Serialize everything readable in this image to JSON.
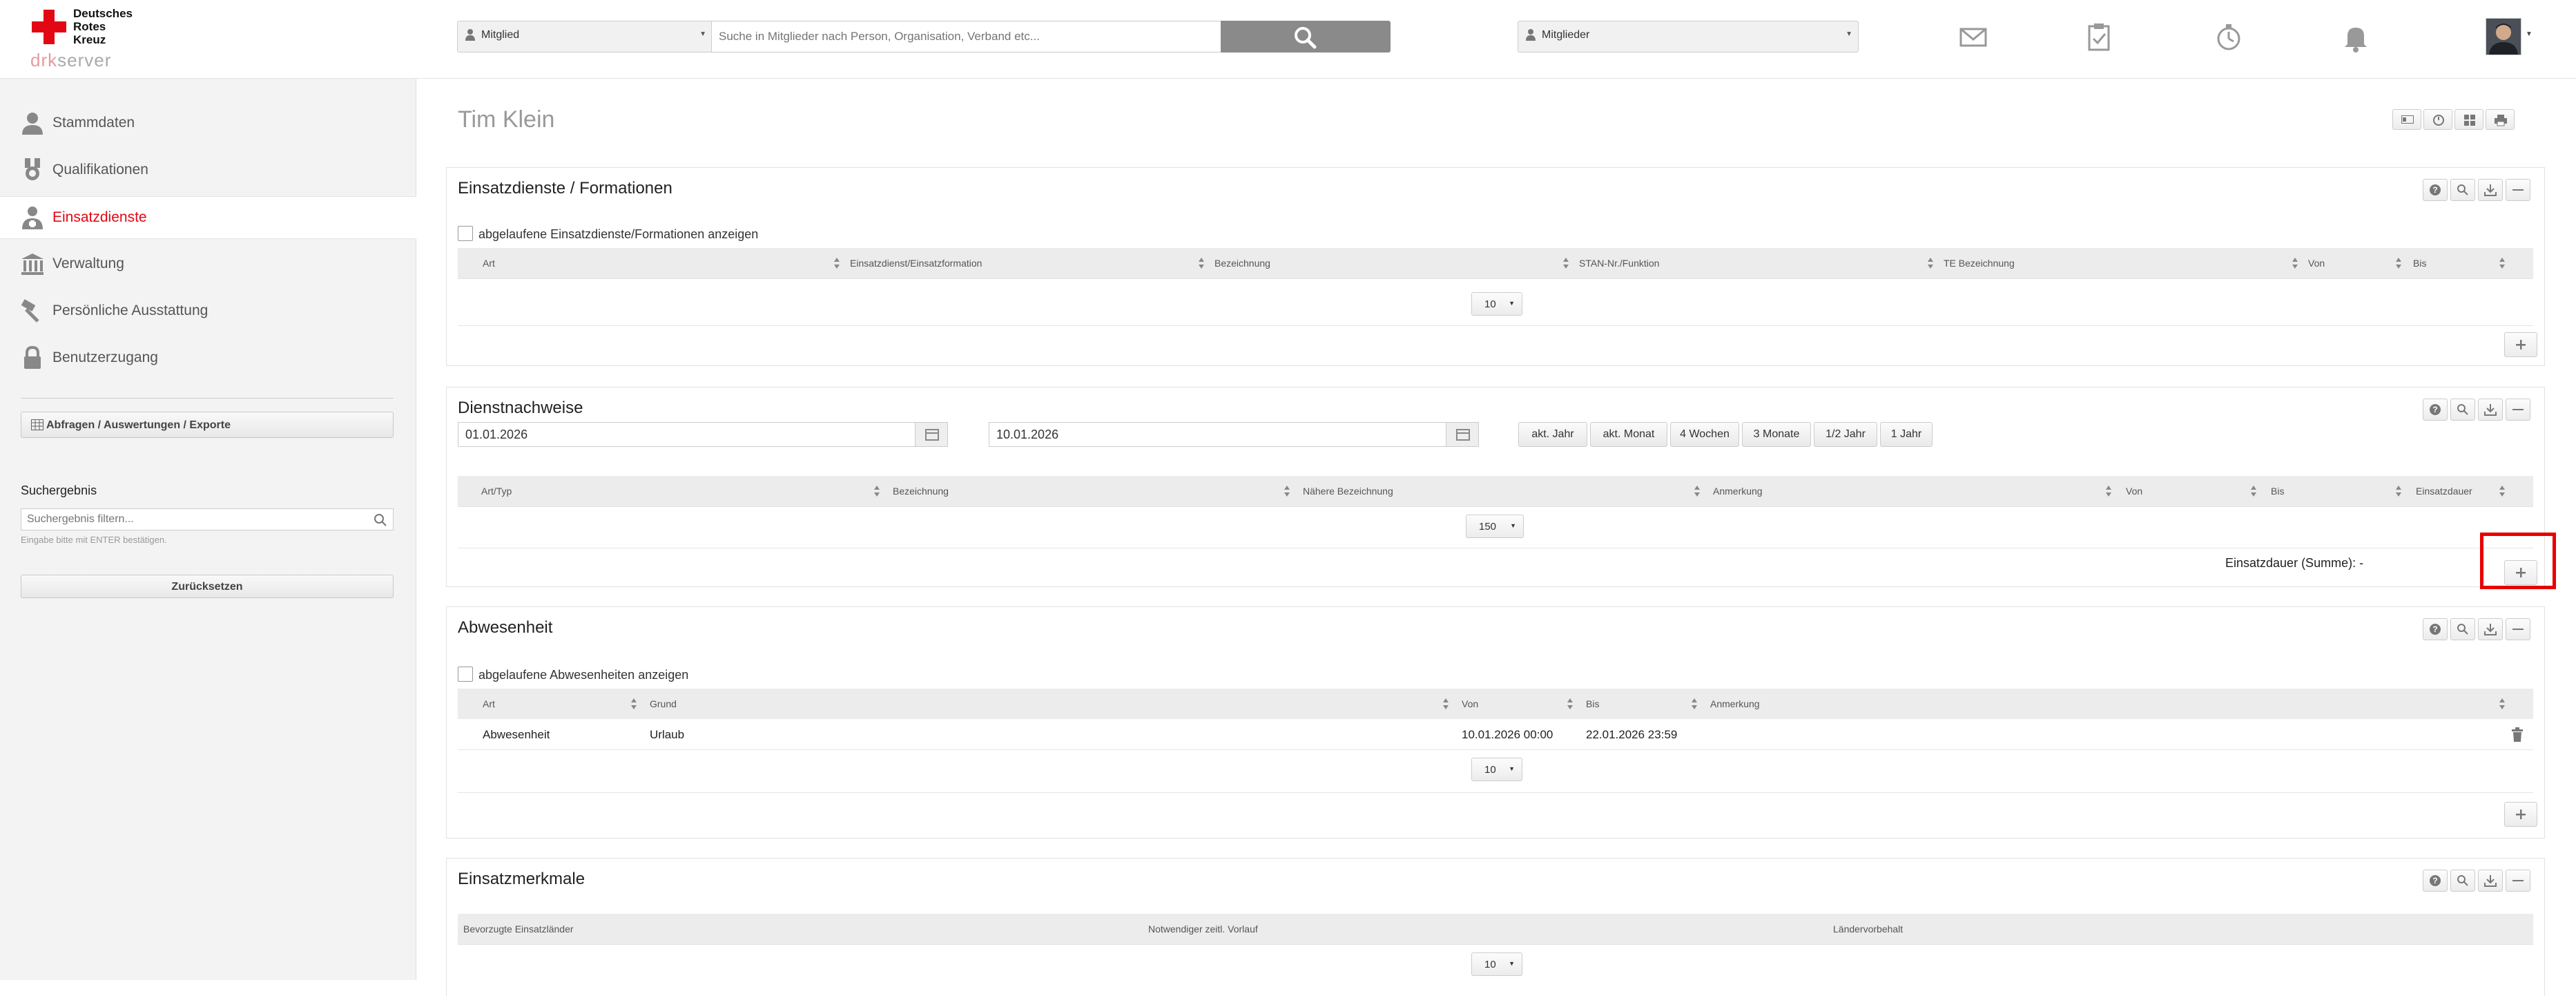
{
  "logo": {
    "line1": "Deutsches",
    "line2": "Rotes",
    "line3": "Kreuz",
    "brand_prefix": "drk",
    "brand_suffix": "server"
  },
  "header": {
    "search_scope": "Mitglied",
    "search_placeholder": "Suche in Mitglieder nach Person, Organisation, Verband etc...",
    "module_select": "Mitglieder",
    "icons": [
      "mail-icon",
      "clipboard-check-icon",
      "stopwatch-icon",
      "bell-icon"
    ]
  },
  "sidebar": {
    "items": [
      {
        "label": "Stammdaten",
        "icon": "person-icon"
      },
      {
        "label": "Qualifikationen",
        "icon": "medal-icon"
      },
      {
        "label": "Einsatzdienste",
        "icon": "responder-icon"
      },
      {
        "label": "Verwaltung",
        "icon": "building-icon"
      },
      {
        "label": "Persönliche Ausstattung",
        "icon": "hammer-icon"
      },
      {
        "label": "Benutzerzugang",
        "icon": "lock-icon"
      }
    ],
    "active_index": 2,
    "reports_button": "Abfragen / Auswertungen / Exporte",
    "search_heading": "Suchergebnis",
    "filter_placeholder": "Suchergebnis filtern...",
    "filter_hint": "Eingabe bitte mit ENTER bestätigen.",
    "reset_button": "Zurücksetzen"
  },
  "main": {
    "person_name": "Tim Klein",
    "panels": {
      "einsatzdienste": {
        "title": "Einsatzdienste / Formationen",
        "checkbox_label": "abgelaufene Einsatzdienste/Formationen anzeigen",
        "columns": [
          "Art",
          "Einsatzdienst/Einsatzformation",
          "Bezeichnung",
          "STAN-Nr./Funktion",
          "TE Bezeichnung",
          "Von",
          "Bis"
        ],
        "page_size": "10"
      },
      "dienstnachweise": {
        "title": "Dienstnachweise",
        "date_from": "01.01.2026",
        "date_to": "10.01.2026",
        "quick_ranges": [
          "akt. Jahr",
          "akt. Monat",
          "4 Wochen",
          "3 Monate",
          "1/2 Jahr",
          "1 Jahr"
        ],
        "columns": [
          "Art/Typ",
          "Bezeichnung",
          "Nähere Bezeichnung",
          "Anmerkung",
          "Von",
          "Bis",
          "Einsatzdauer"
        ],
        "page_size": "150",
        "sum_label": "Einsatzdauer (Summe): -"
      },
      "abwesenheit": {
        "title": "Abwesenheit",
        "checkbox_label": "abgelaufene Abwesenheiten anzeigen",
        "columns": [
          "Art",
          "Grund",
          "Von",
          "Bis",
          "Anmerkung"
        ],
        "rows": [
          {
            "art": "Abwesenheit",
            "grund": "Urlaub",
            "von": "10.01.2026 00:00",
            "bis": "22.01.2026 23:59",
            "anmerkung": ""
          }
        ],
        "page_size": "10"
      },
      "einsatzmerkmale": {
        "title": "Einsatzmerkmale",
        "columns": [
          "Bevorzugte Einsatzländer",
          "Notwendiger zeitl. Vorlauf",
          "Ländervorbehalt"
        ],
        "page_size": "10"
      }
    }
  },
  "colors": {
    "accent": "#e30613",
    "highlight": "#e80000",
    "search_button": "#8a8a8a"
  }
}
